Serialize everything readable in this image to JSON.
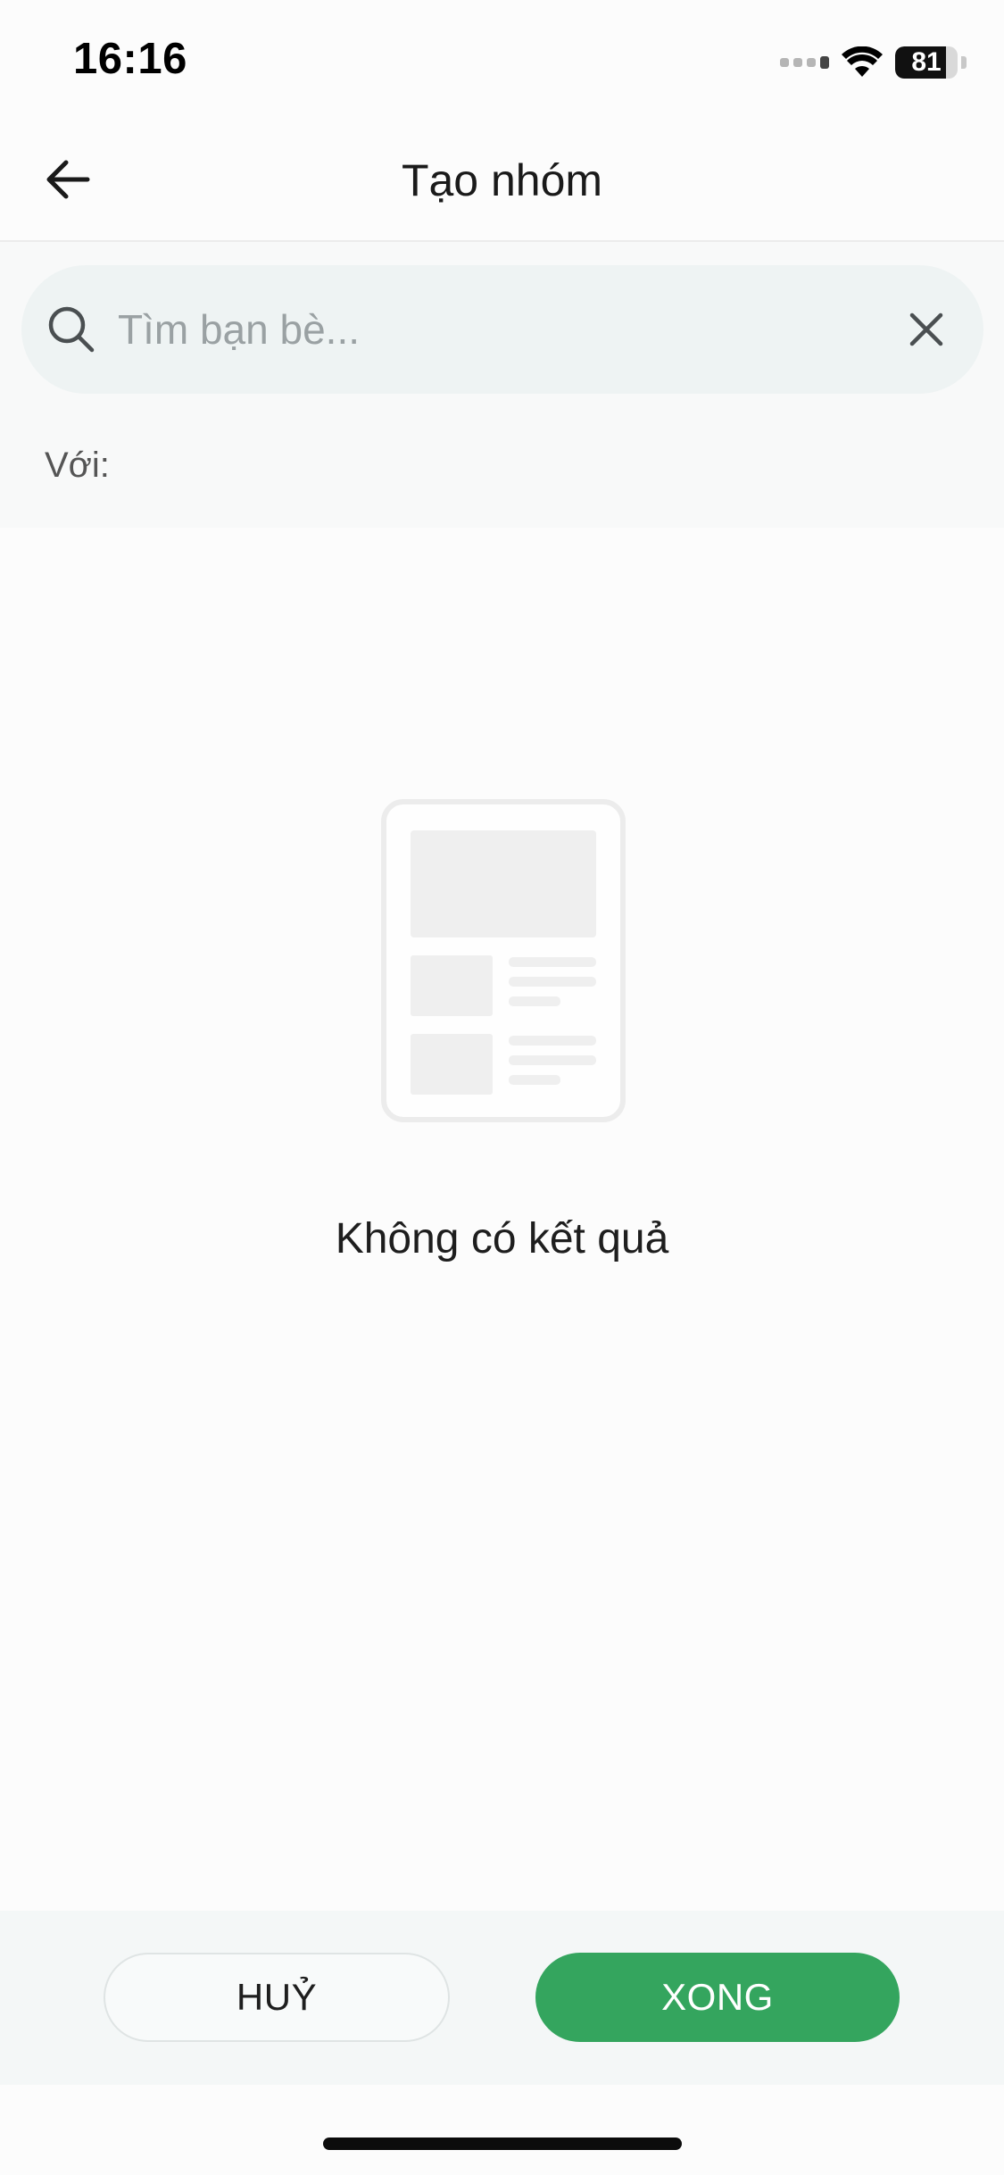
{
  "status_bar": {
    "time": "16:16",
    "battery": "81",
    "battery_level": 0.81
  },
  "header": {
    "title": "Tạo nhóm",
    "back_icon": "arrow-left-icon"
  },
  "search": {
    "placeholder": "Tìm bạn bè...",
    "value": "",
    "search_icon": "search-icon",
    "clear_icon": "close-icon"
  },
  "with_label": "Với:",
  "empty_state": {
    "message": "Không có kết quả",
    "illustration": "empty-document-icon"
  },
  "actions": {
    "cancel_label": "HUỶ",
    "done_label": "XONG"
  },
  "colors": {
    "accent": "#34a55e",
    "search_bg": "#eef3f3",
    "page_bg": "#fcfcfc"
  }
}
